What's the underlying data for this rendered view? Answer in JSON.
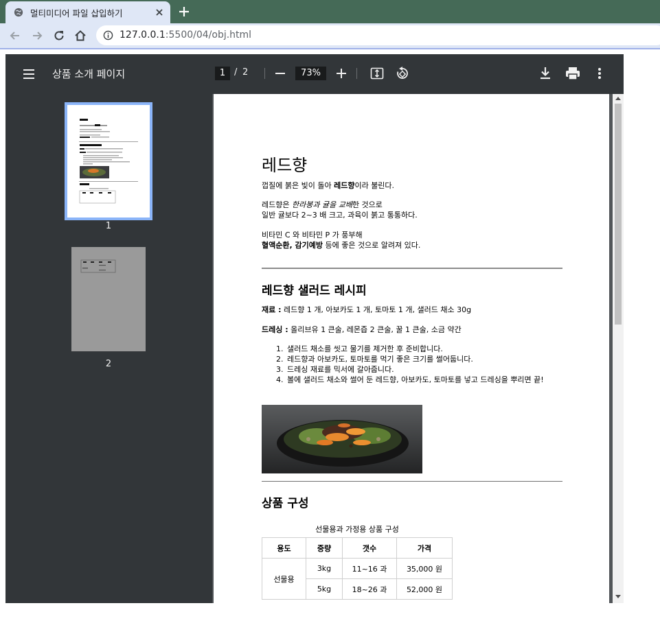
{
  "browser": {
    "tab_title": "멀티미디어 파일 삽입하기",
    "url_host": "127.0.0.1",
    "url_rest": ":5500/04/obj.html"
  },
  "viewer": {
    "title": "상품 소개 페이지",
    "current_page": "1",
    "page_separator": "/",
    "total_pages": "2",
    "zoom": "73%",
    "thumbnails": [
      "1",
      "2"
    ]
  },
  "document": {
    "h1": "레드향",
    "p1_pre": "껍질에 붉은 빛이 돌아 ",
    "p1_bold": "레드향",
    "p1_post": "이라 불린다.",
    "p2_pre": "레드향은 ",
    "p2_italic": "한라봉과 귤을 교배",
    "p2_post": "한 것으로",
    "p2_line2": "일반 귤보다 2~3 배 크고, 과육이 붉고 통통하다.",
    "p3_line1": "비타민 C 와 비타민 P 가 풍부해",
    "p3_bold": "혈액순환, 감기예방",
    "p3_post": " 등에 좋은 것으로 알려져 있다.",
    "h2_recipe": "레드향 샐러드 레시피",
    "ingredients_label": "재료 :",
    "ingredients": " 레드향 1 개, 아보카도 1 개, 토마토 1 개, 샐러드 채소 30g",
    "dressing_label": "드레싱 :",
    "dressing": " 올리브유 1 큰술, 레몬즙 2 큰술, 꿀 1 큰술, 소금 약간",
    "steps": [
      "샐러드 채소를 씻고 물기를 제거한 후 준비합니다.",
      "레드향과 아보카도, 토마토를 먹기 좋은 크기를 썰어둡니다.",
      "드레싱 재료를 믹서에 갈아줍니다.",
      "볼에 샐러드 채소와 썰어 둔 레드향, 아보카도, 토마토를 넣고 드레싱을 뿌리면 끝!"
    ],
    "h2_product": "상품 구성",
    "table_caption": "선물용과 가정용 상품 구성",
    "table_headers": [
      "용도",
      "중량",
      "갯수",
      "가격"
    ],
    "table_group": "선물용",
    "table_rows": [
      [
        "3kg",
        "11~16 과",
        "35,000 원"
      ],
      [
        "5kg",
        "18~26 과",
        "52,000 원"
      ]
    ]
  },
  "colors": {
    "tabstrip": "#456a57",
    "toolbar": "#dfe7f6",
    "pdf_toolbar": "#323639",
    "pdf_background": "#525659",
    "thumbnail_highlight": "#8ab4f8"
  }
}
